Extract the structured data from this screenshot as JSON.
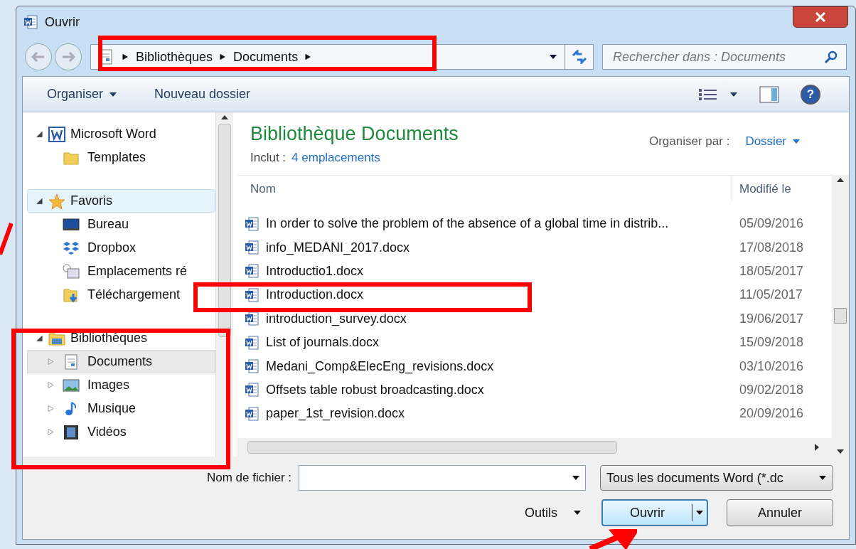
{
  "window": {
    "title": "Ouvrir"
  },
  "address": {
    "crumbs": [
      "Bibliothèques",
      "Documents"
    ]
  },
  "search": {
    "placeholder": "Rechercher dans : Documents"
  },
  "toolbar": {
    "organize": "Organiser",
    "new_folder": "Nouveau dossier"
  },
  "nav": [
    {
      "label": "Microsoft Word",
      "kind": "word",
      "expanded": true,
      "selected": false,
      "children": [
        {
          "label": "Templates",
          "kind": "folder",
          "selected": false
        }
      ]
    },
    {
      "label": "Favoris",
      "kind": "star",
      "expanded": true,
      "selected": true,
      "children": [
        {
          "label": "Bureau",
          "kind": "desktop",
          "selected": false
        },
        {
          "label": "Dropbox",
          "kind": "dropbox",
          "selected": false
        },
        {
          "label": "Emplacements ré",
          "kind": "recent",
          "selected": false
        },
        {
          "label": "Téléchargement",
          "kind": "downloads",
          "selected": false
        }
      ]
    },
    {
      "label": "Bibliothèques",
      "kind": "library",
      "expanded": true,
      "selected": false,
      "children": [
        {
          "label": "Documents",
          "kind": "documents",
          "expanded": false,
          "selected": true
        },
        {
          "label": "Images",
          "kind": "images",
          "expanded": false,
          "selected": false
        },
        {
          "label": "Musique",
          "kind": "music",
          "expanded": false,
          "selected": false
        },
        {
          "label": "Vidéos",
          "kind": "videos",
          "expanded": false,
          "selected": false
        }
      ]
    }
  ],
  "library": {
    "title": "Bibliothèque Documents",
    "includes_label": "Inclut :",
    "includes_link": "4 emplacements",
    "arrange_label": "Organiser par :",
    "arrange_value": "Dossier"
  },
  "columns": [
    "Nom",
    "Modifié le"
  ],
  "files": [
    {
      "name": "In order to solve the problem of the absence of a global time in distrib...",
      "date": "05/09/2016"
    },
    {
      "name": "info_MEDANI_2017.docx",
      "date": "17/08/2018"
    },
    {
      "name": "Introductio1.docx",
      "date": "18/05/2017"
    },
    {
      "name": "Introduction.docx",
      "date": "11/05/2017"
    },
    {
      "name": "introduction_survey.docx",
      "date": "19/06/2017"
    },
    {
      "name": "List of journals.docx",
      "date": "15/09/2018"
    },
    {
      "name": "Medani_Comp&ElecEng_revisions.docx",
      "date": "03/10/2016"
    },
    {
      "name": "Offsets table robust broadcasting.docx",
      "date": "09/02/2018"
    },
    {
      "name": "paper_1st_revision.docx",
      "date": "20/09/2016"
    }
  ],
  "filename": {
    "label": "Nom de fichier :"
  },
  "filetype": {
    "value": "Tous les documents Word (*.dc"
  },
  "tools": "Outils",
  "help": "?",
  "buttons": {
    "open": "Ouvrir",
    "cancel": "Annuler"
  }
}
